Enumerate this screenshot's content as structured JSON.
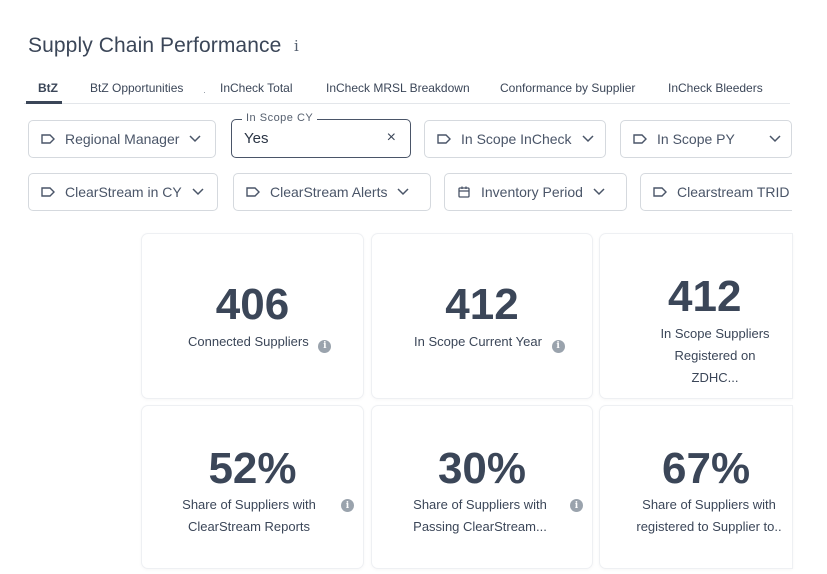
{
  "header": {
    "title": "Supply Chain Performance",
    "info_glyph": "i"
  },
  "tabs": [
    {
      "label": "BtZ",
      "active": true
    },
    {
      "label": "BtZ Opportunities"
    },
    {
      "label": "InCheck Total"
    },
    {
      "label": "InCheck MRSL Breakdown"
    },
    {
      "label": "Conformance by Supplier"
    },
    {
      "label": "InCheck Bleeders"
    }
  ],
  "filters": {
    "row1": [
      {
        "label": "Regional Manager",
        "icon": "tag-icon"
      },
      {
        "floating_label": "In Scope CY",
        "value": "Yes",
        "clear": "×"
      },
      {
        "label": "In Scope InCheck",
        "icon": "tag-icon"
      },
      {
        "label": "In Scope PY",
        "icon": "tag-icon"
      }
    ],
    "row2": [
      {
        "label": "ClearStream in CY",
        "icon": "tag-icon"
      },
      {
        "label": "ClearStream Alerts",
        "icon": "tag-icon"
      },
      {
        "label": "Inventory Period",
        "icon": "calendar-icon"
      },
      {
        "label": "Clearstream TRID",
        "icon": "tag-icon"
      }
    ]
  },
  "kpis": [
    {
      "value": "406",
      "line1": "Connected Suppliers",
      "line2": ""
    },
    {
      "value": "412",
      "line1": "In Scope Current Year",
      "line2": ""
    },
    {
      "value": "412",
      "line1": "In Scope Suppliers",
      "line2": "Registered on ZDHC..."
    },
    {
      "value": "52%",
      "line1": "Share of Suppliers with",
      "line2": "ClearStream Reports"
    },
    {
      "value": "30%",
      "line1": "Share of Suppliers with",
      "line2": "Passing ClearStream..."
    },
    {
      "value": "67%",
      "line1": "Share of Suppliers with",
      "line2": "registered to Supplier to.."
    }
  ],
  "colors": {
    "text": "#3b4658",
    "border": "#d5d9de",
    "info_dot": "#9aa3ad"
  }
}
